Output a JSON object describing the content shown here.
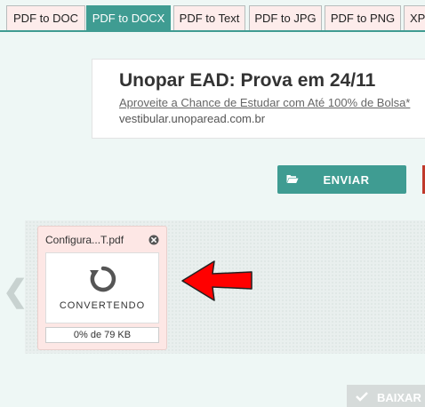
{
  "tabs": [
    {
      "label": "PDF to DOC",
      "active": false
    },
    {
      "label": "PDF to DOCX",
      "active": true
    },
    {
      "label": "PDF to Text",
      "active": false
    },
    {
      "label": "PDF to JPG",
      "active": false
    },
    {
      "label": "PDF to PNG",
      "active": false
    },
    {
      "label": "XP",
      "active": false
    }
  ],
  "ad": {
    "title": "Unopar EAD: Prova em 24/11",
    "link": "Aproveite a Chance de Estudar com Até 100% de Bolsa*",
    "url": "vestibular.unoparead.com.br"
  },
  "enviar": {
    "label": "ENVIAR",
    "icon": "folder-open-icon"
  },
  "file": {
    "name": "Configura...T.pdf",
    "status": "CONVERTENDO",
    "progress_text": "0% de 79 KB",
    "progress_fraction": 0
  },
  "baixar": {
    "label": "BAIXAR",
    "icon": "check-icon"
  },
  "nav": {
    "prev_symbol": "❮"
  },
  "colors": {
    "accent": "#3f9c92",
    "card_bg": "#fde7e5",
    "arrow": "#ff0000",
    "disabled": "#d6dbda"
  }
}
